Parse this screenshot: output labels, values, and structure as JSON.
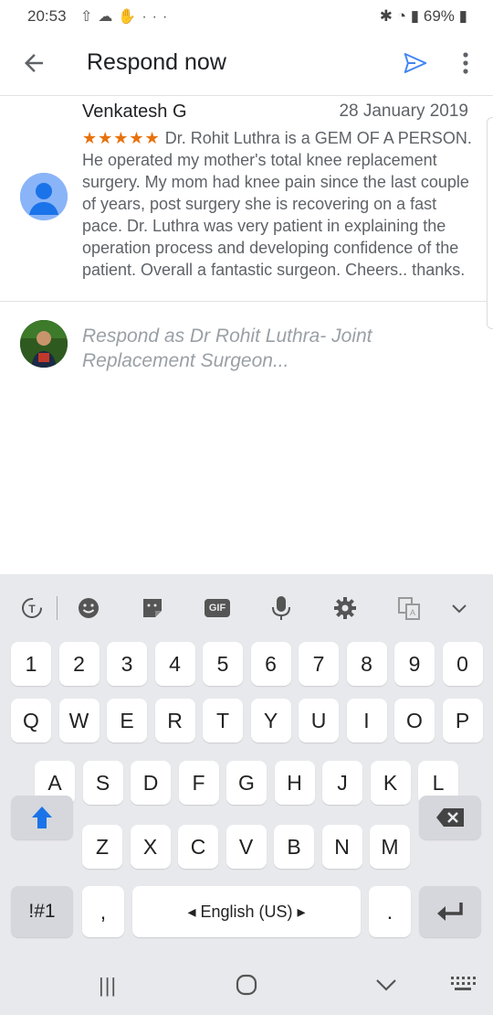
{
  "status_bar": {
    "time": "20:53",
    "left_icons": [
      "upload-icon",
      "cloud-icon",
      "hand-icon",
      "more-icon"
    ],
    "battery": "69%"
  },
  "app_bar": {
    "title": "Respond now",
    "back_icon": "arrow-left-icon",
    "send_icon": "send-icon",
    "more_icon": "more-vertical-icon",
    "send_color": "#4285f4"
  },
  "review": {
    "reviewer": "Venkatesh G",
    "date": "28 January 2019",
    "stars": "★★★★★",
    "rating": 5,
    "text": "Dr. Rohit Luthra is a GEM OF A PERSON. He operated my mother's total knee replacement surgery. My mom had knee pain since the last couple of years, post surgery she is recovering on a fast pace. Dr. Luthra was very patient in explaining the operation  process and developing confidence of the patient. Overall a fantastic surgeon. Cheers.. thanks.",
    "star_color": "#e8710a"
  },
  "respond": {
    "placeholder": "Respond as Dr Rohit Luthra- Joint Replacement Surgeon...",
    "value": ""
  },
  "keyboard": {
    "toolbar": [
      "text-translate-icon",
      "emoji-icon",
      "sticker-icon",
      "gif-icon",
      "mic-icon",
      "settings-icon",
      "clipboard-icon",
      "chevron-down-icon"
    ],
    "gif_label": "GIF",
    "row_numbers": [
      "1",
      "2",
      "3",
      "4",
      "5",
      "6",
      "7",
      "8",
      "9",
      "0"
    ],
    "row1": [
      "Q",
      "W",
      "E",
      "R",
      "T",
      "Y",
      "U",
      "I",
      "O",
      "P"
    ],
    "row2": [
      "A",
      "S",
      "D",
      "F",
      "G",
      "H",
      "J",
      "K",
      "L"
    ],
    "row3": [
      "Z",
      "X",
      "C",
      "V",
      "B",
      "N",
      "M"
    ],
    "symbols": "!#1",
    "comma": ",",
    "space": "◂ English (US) ▸",
    "period": ".",
    "shift_color": "#1a73e8"
  },
  "nav_bar": {
    "recents": "|||",
    "home_icon": "home-icon",
    "back_icon": "chevron-down-icon",
    "keyboard_icon": "keyboard-icon"
  }
}
